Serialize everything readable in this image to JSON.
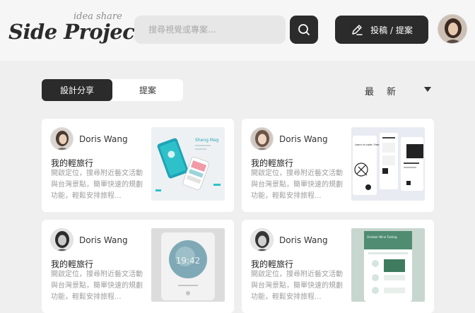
{
  "header": {
    "logo": "Side Project",
    "logo_tagline": "idea share",
    "search_placeholder": "搜尋視覺或專案...",
    "post_button_label": "投稿 / 提案"
  },
  "tabs": [
    {
      "label": "設計分享",
      "active": true
    },
    {
      "label": "提案",
      "active": false
    }
  ],
  "sort": {
    "selected": "最新"
  },
  "cards": [
    {
      "author": "Doris Wang",
      "title": "我的輕旅行",
      "description": "開啟定位，搜尋附近藝文活動與台灣景點，簡單快速的規劃功能，輕鬆安排旅程..."
    },
    {
      "author": "Doris Wang",
      "title": "我的輕旅行",
      "description": "開啟定位，搜尋附近藝文活動與台灣景點，簡單快速的規劃功能，輕鬆安排旅程..."
    },
    {
      "author": "Doris Wang",
      "title": "我的輕旅行",
      "description": "開啟定位，搜尋附近藝文活動與台灣景點，簡單快速的規劃功能，輕鬆安排旅程..."
    },
    {
      "author": "Doris Wang",
      "title": "我的輕旅行",
      "description": "開啟定位，搜尋附近藝文活動與台灣景點，簡單快速的規劃功能，輕鬆安排旅程..."
    }
  ],
  "thumbnails": {
    "card1": {
      "app_label": "Sheng Mag"
    },
    "card2": {
      "caption": "Learn to code. Free for students."
    },
    "card3": {
      "time": "19:42"
    },
    "card4": {
      "header": "October Wine Tasting"
    }
  },
  "icons": {
    "search": "search-icon",
    "post": "pencil-icon",
    "sort": "caret-down-icon"
  },
  "colors": {
    "primary_dark": "#2b2b2b",
    "background": "#efefef",
    "card": "#ffffff"
  }
}
